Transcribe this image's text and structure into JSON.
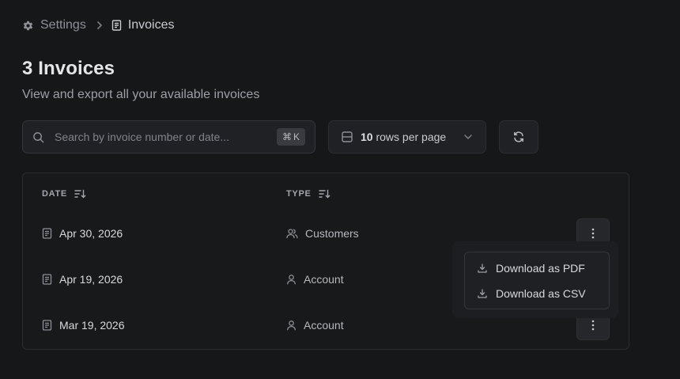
{
  "breadcrumb": {
    "parent_label": "Settings",
    "parent_icon": "gear-icon",
    "current_label": "Invoices",
    "current_icon": "document-icon"
  },
  "header": {
    "title": "3 Invoices",
    "subtitle": "View and export all your available invoices"
  },
  "toolbar": {
    "search_placeholder": "Search by invoice number or date...",
    "search_value": "",
    "shortcut_symbol": "⌘",
    "shortcut_key": "K",
    "rows_count": "10",
    "rows_suffix": " rows per page",
    "refresh_icon": "refresh-icon"
  },
  "table": {
    "columns": [
      {
        "label": "DATE",
        "icon": "sort-icon"
      },
      {
        "label": "TYPE",
        "icon": "sort-icon"
      }
    ],
    "rows": [
      {
        "date": "Apr 30, 2026",
        "type": "Customers",
        "type_icon": "users-icon"
      },
      {
        "date": "Apr 19, 2026",
        "type": "Account",
        "type_icon": "user-icon"
      },
      {
        "date": "Mar 19, 2026",
        "type": "Account",
        "type_icon": "user-icon"
      }
    ]
  },
  "row_menu": {
    "items": [
      {
        "label": "Download as PDF",
        "icon": "download-icon"
      },
      {
        "label": "Download as CSV",
        "icon": "download-icon"
      }
    ]
  }
}
